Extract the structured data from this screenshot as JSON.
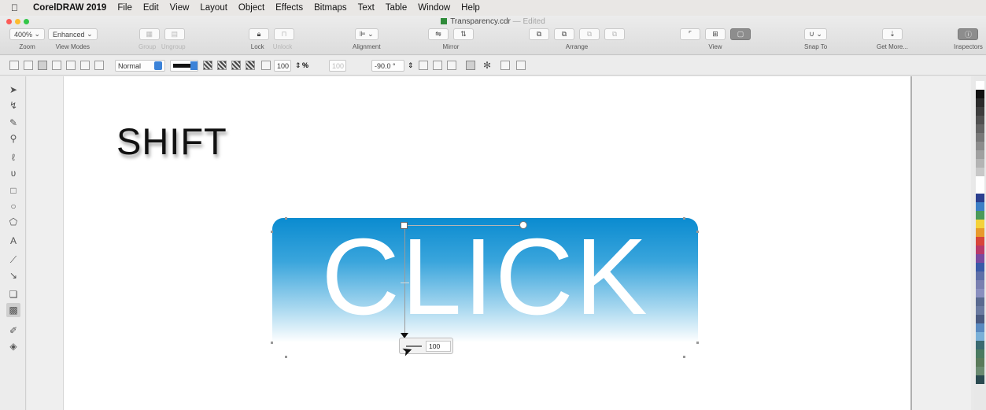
{
  "menubar": {
    "app": "CorelDRAW 2019",
    "items": [
      "File",
      "Edit",
      "View",
      "Layout",
      "Object",
      "Effects",
      "Bitmaps",
      "Text",
      "Table",
      "Window",
      "Help"
    ]
  },
  "title": {
    "filename": "Transparency.cdr",
    "status": "— Edited"
  },
  "toolbar": {
    "zoom_value": "400%",
    "view_mode": "Enhanced",
    "labels": {
      "zoom": "Zoom",
      "view_modes": "View Modes",
      "group": "Group",
      "ungroup": "Ungroup",
      "lock": "Lock",
      "unlock": "Unlock",
      "alignment": "Alignment",
      "mirror": "Mirror",
      "arrange": "Arrange",
      "view": "View",
      "snap_to": "Snap To",
      "get_more": "Get More...",
      "inspectors": "Inspectors"
    }
  },
  "propbar": {
    "merge_mode": "Normal",
    "transparency": "100",
    "percent": "%",
    "angle_dim": "100",
    "angle": "-90.0 °"
  },
  "canvas": {
    "shift_text": "SHIFT",
    "click_text": "CLICK",
    "transparency_value": "100"
  },
  "colors": {
    "banner_top": "#0a8bd0",
    "banner_bottom": "#ffffff",
    "accent": "#0a8bd0"
  },
  "palette": [
    "#ffffff",
    "#111111",
    "#2b2b2b",
    "#3d3d3d",
    "#505050",
    "#646464",
    "#787878",
    "#8c8c8c",
    "#a0a0a0",
    "#b4b4b4",
    "#c8c8c8",
    "#ffffff",
    "#ffffff",
    "#2b3f8f",
    "#3c7fc6",
    "#4a9a5a",
    "#f4d23a",
    "#e89a2c",
    "#d8463a",
    "#b83a6a",
    "#7a4aa0",
    "#3a5aa8",
    "#5f6fa8",
    "#7a7fb0",
    "#8a8fbf",
    "#5a6a90",
    "#6a7aa0",
    "#4a5a80",
    "#5a8ac0",
    "#7ab0d8",
    "#3a6a70",
    "#4a7a60",
    "#5a7a5a",
    "#6a8a70",
    "#2a4a50"
  ]
}
